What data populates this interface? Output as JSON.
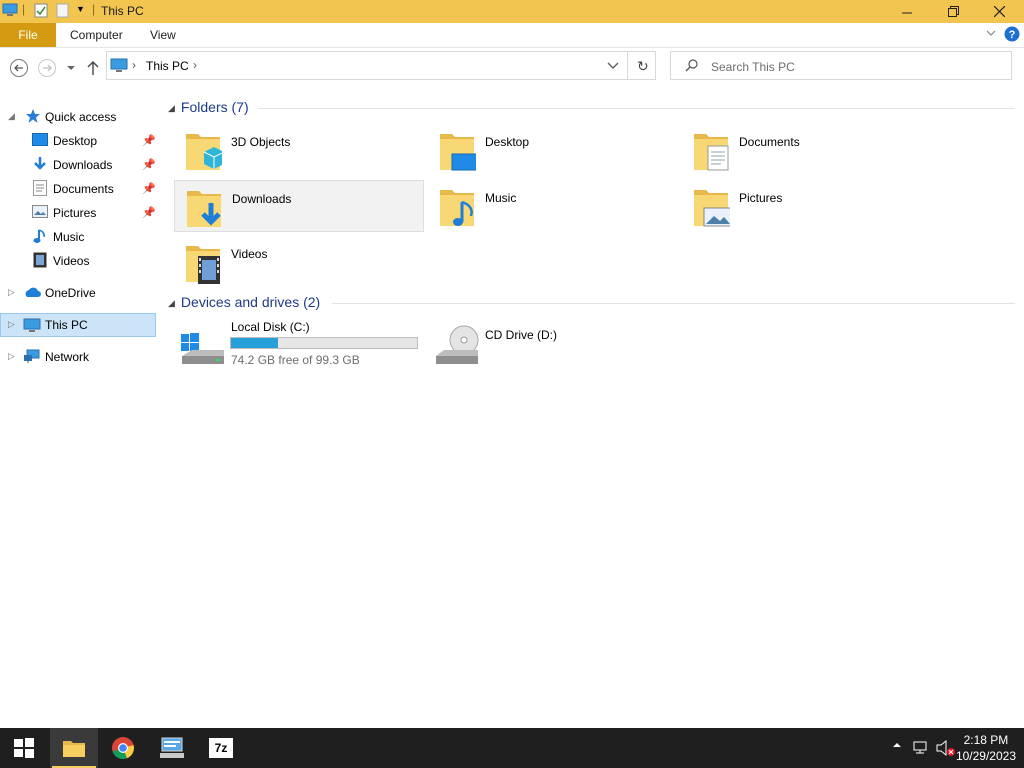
{
  "window": {
    "title": "This PC",
    "colors": {
      "titlebar": "#f1c550",
      "file_tab": "#d49b10",
      "accent": "#26a0da",
      "selection": "#cce4f7"
    }
  },
  "ribbon": {
    "tabs": [
      "File",
      "Computer",
      "View"
    ]
  },
  "address": {
    "path": [
      "This PC"
    ],
    "search_placeholder": "Search This PC"
  },
  "nav": {
    "quick_access": "Quick access",
    "quick_items": [
      {
        "label": "Desktop",
        "icon": "desktop-icon",
        "pinned": true
      },
      {
        "label": "Downloads",
        "icon": "downloads-icon",
        "pinned": true
      },
      {
        "label": "Documents",
        "icon": "documents-icon",
        "pinned": true
      },
      {
        "label": "Pictures",
        "icon": "pictures-icon",
        "pinned": true
      },
      {
        "label": "Music",
        "icon": "music-icon",
        "pinned": false
      },
      {
        "label": "Videos",
        "icon": "videos-icon",
        "pinned": false
      }
    ],
    "onedrive": "OneDrive",
    "this_pc": "This PC",
    "network": "Network"
  },
  "content": {
    "folders_header": "Folders (7)",
    "folders": [
      {
        "name": "3D Objects",
        "icon": "3d-objects-icon"
      },
      {
        "name": "Desktop",
        "icon": "desktop-icon"
      },
      {
        "name": "Documents",
        "icon": "documents-icon"
      },
      {
        "name": "Downloads",
        "icon": "downloads-icon"
      },
      {
        "name": "Music",
        "icon": "music-icon"
      },
      {
        "name": "Pictures",
        "icon": "pictures-icon"
      },
      {
        "name": "Videos",
        "icon": "videos-icon"
      }
    ],
    "drives_header": "Devices and drives (2)",
    "drives": [
      {
        "name": "Local Disk (C:)",
        "free_text": "74.2 GB free of 99.3 GB",
        "used_fraction": 0.253
      },
      {
        "name": "CD Drive (D:)"
      }
    ]
  },
  "taskbar": {
    "apps": [
      "start-icon",
      "file-explorer-icon",
      "chrome-icon",
      "network-app-icon",
      "7zip-icon"
    ],
    "app_7z_label": "7z",
    "time": "2:18 PM",
    "date": "10/29/2023"
  }
}
